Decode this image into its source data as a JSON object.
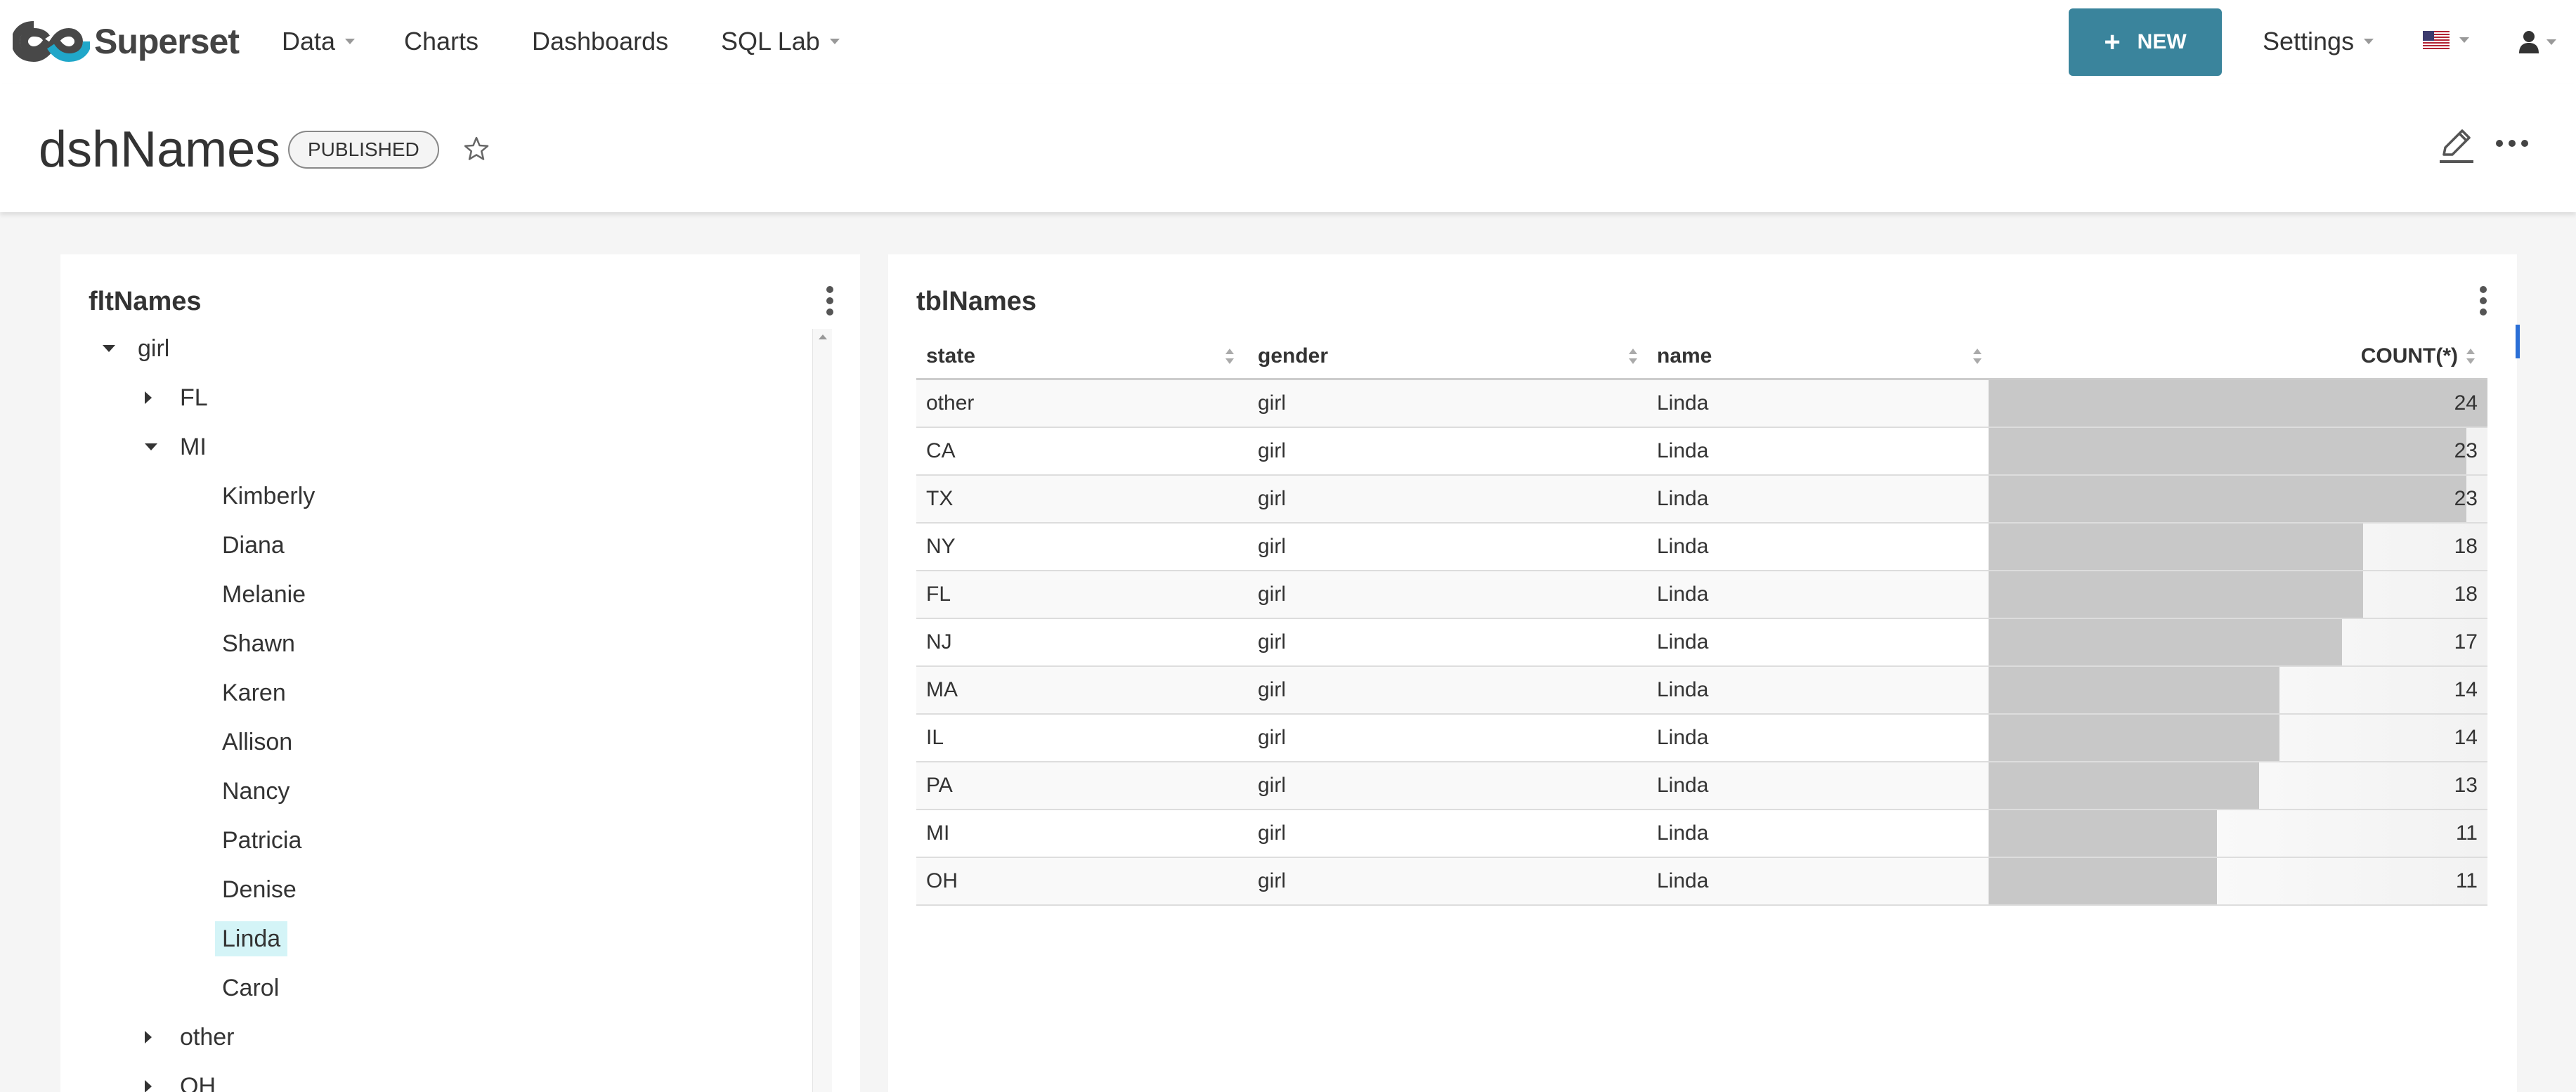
{
  "navbar": {
    "brand": "Superset",
    "items": [
      {
        "label": "Data",
        "has_caret": true
      },
      {
        "label": "Charts",
        "has_caret": false
      },
      {
        "label": "Dashboards",
        "has_caret": false
      },
      {
        "label": "SQL Lab",
        "has_caret": true
      }
    ],
    "new_button": "NEW",
    "settings": "Settings",
    "language_icon": "us-flag-icon",
    "user_icon": "user-icon",
    "accent_color": "#3a849c"
  },
  "header": {
    "title": "dshNames",
    "status_badge": "PUBLISHED"
  },
  "filter_panel": {
    "title": "fltNames",
    "tree": [
      {
        "label": "girl",
        "level": 0,
        "expanded": true
      },
      {
        "label": "FL",
        "level": 1,
        "expanded": false
      },
      {
        "label": "MI",
        "level": 1,
        "expanded": true
      },
      {
        "label": "Kimberly",
        "level": 2
      },
      {
        "label": "Diana",
        "level": 2
      },
      {
        "label": "Melanie",
        "level": 2
      },
      {
        "label": "Shawn",
        "level": 2
      },
      {
        "label": "Karen",
        "level": 2
      },
      {
        "label": "Allison",
        "level": 2
      },
      {
        "label": "Nancy",
        "level": 2
      },
      {
        "label": "Patricia",
        "level": 2
      },
      {
        "label": "Denise",
        "level": 2
      },
      {
        "label": "Linda",
        "level": 2,
        "selected": true
      },
      {
        "label": "Carol",
        "level": 2
      },
      {
        "label": "other",
        "level": 1,
        "expanded": false
      },
      {
        "label": "OH",
        "level": 1,
        "expanded": false
      }
    ]
  },
  "table_panel": {
    "title": "tblNames",
    "columns": [
      "state",
      "gender",
      "name",
      "COUNT(*)"
    ],
    "rows": [
      {
        "state": "other",
        "gender": "girl",
        "name": "Linda",
        "count": 24
      },
      {
        "state": "CA",
        "gender": "girl",
        "name": "Linda",
        "count": 23
      },
      {
        "state": "TX",
        "gender": "girl",
        "name": "Linda",
        "count": 23
      },
      {
        "state": "NY",
        "gender": "girl",
        "name": "Linda",
        "count": 18
      },
      {
        "state": "FL",
        "gender": "girl",
        "name": "Linda",
        "count": 18
      },
      {
        "state": "NJ",
        "gender": "girl",
        "name": "Linda",
        "count": 17
      },
      {
        "state": "MA",
        "gender": "girl",
        "name": "Linda",
        "count": 14
      },
      {
        "state": "IL",
        "gender": "girl",
        "name": "Linda",
        "count": 14
      },
      {
        "state": "PA",
        "gender": "girl",
        "name": "Linda",
        "count": 13
      },
      {
        "state": "MI",
        "gender": "girl",
        "name": "Linda",
        "count": 11
      },
      {
        "state": "OH",
        "gender": "girl",
        "name": "Linda",
        "count": 11
      }
    ],
    "count_max": 24
  }
}
